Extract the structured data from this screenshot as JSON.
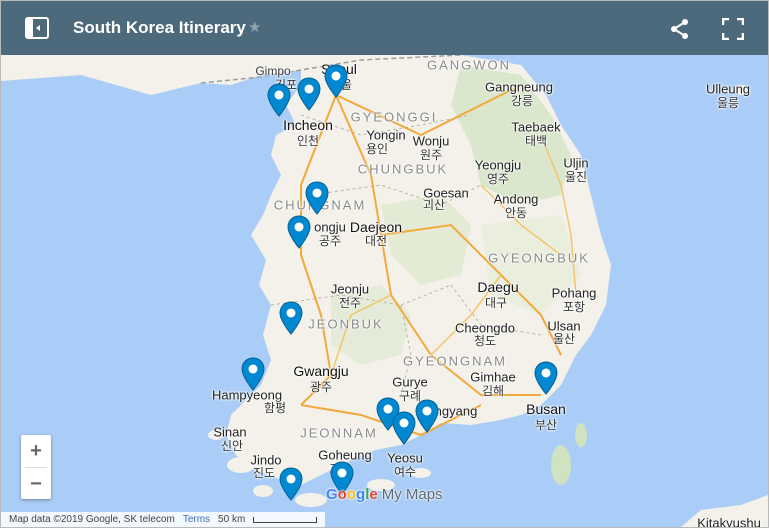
{
  "header": {
    "title": "South Korea Itinerary",
    "panel_icon": "side-panel-icon",
    "star_icon": "star-icon",
    "share_icon": "share-icon",
    "fullscreen_icon": "fullscreen-icon",
    "bar_color": "#4c6a7c"
  },
  "map": {
    "water_color": "#a9cdf6",
    "land_color": "#f3f1ea",
    "labels": {
      "gangwon": "GANGWON",
      "gyeonggi": "GYEONGGI",
      "chungbuk": "CHUNGBUK",
      "chungnam": "CHUNGNAM",
      "gyeongbuk": "GYEONGBUK",
      "jeonbuk": "JEONBUK",
      "gyeongnam": "GYEONGNAM",
      "jeonnam": "JEONNAM",
      "gimpo": "Gimpo",
      "gimpo_kr": "김포",
      "seoul": "Seoul",
      "seoul_kr": "서울",
      "incheon": "Incheon",
      "incheon_kr": "인천",
      "yongin": "Yongin",
      "yongin_kr": "용인",
      "wonju": "Wonju",
      "wonju_kr": "원주",
      "gangneung": "Gangneung",
      "gangneung_kr": "강릉",
      "taebaek": "Taebaek",
      "taebaek_kr": "태백",
      "ulleung": "Ulleung",
      "ulleung_kr": "울릉",
      "uljin": "Uljin",
      "uljin_kr": "울진",
      "yeongju": "Yeongju",
      "yeongju_kr": "영주",
      "goesan": "Goesan",
      "goesan_kr": "괴산",
      "andong": "Andong",
      "andong_kr": "안동",
      "gongju": "ongju",
      "gongju_kr": "공주",
      "daejeon": "Daejeon",
      "daejeon_kr": "대전",
      "daegu": "Daegu",
      "daegu_kr": "대구",
      "pohang": "Pohang",
      "pohang_kr": "포항",
      "jeonju": "Jeonju",
      "jeonju_kr": "전주",
      "cheongdo": "Cheongdo",
      "cheongdo_kr": "청도",
      "ulsan": "Ulsan",
      "ulsan_kr": "울산",
      "gwangju": "Gwangju",
      "gwangju_kr": "광주",
      "gurye": "Gurye",
      "gurye_kr": "구례",
      "gimhae": "Gimhae",
      "gimhae_kr": "김해",
      "gwangyang": "ngyang",
      "busan": "Busan",
      "busan_kr": "부산",
      "hampyeong": "Hampyeong",
      "hampyeong_kr": "함평",
      "sinan": "Sinan",
      "sinan_kr": "신안",
      "jindo": "Jindo",
      "jindo_kr": "진도",
      "goheung": "Goheung",
      "goheung_kr": "고흥",
      "yeosu": "Yeosu",
      "yeosu_kr": "여수",
      "kitakyushu": "Kitakyushu"
    },
    "marker_color": "#0288d1",
    "marker_icon": "location-pin-icon"
  },
  "controls": {
    "zoom_in": "+",
    "zoom_out": "−"
  },
  "footer": {
    "attribution": "Map data ©2019 Google, SK telecom",
    "terms": "Terms",
    "scale": "50 km"
  },
  "logo": {
    "google": "Google",
    "mymaps": "My Maps"
  }
}
